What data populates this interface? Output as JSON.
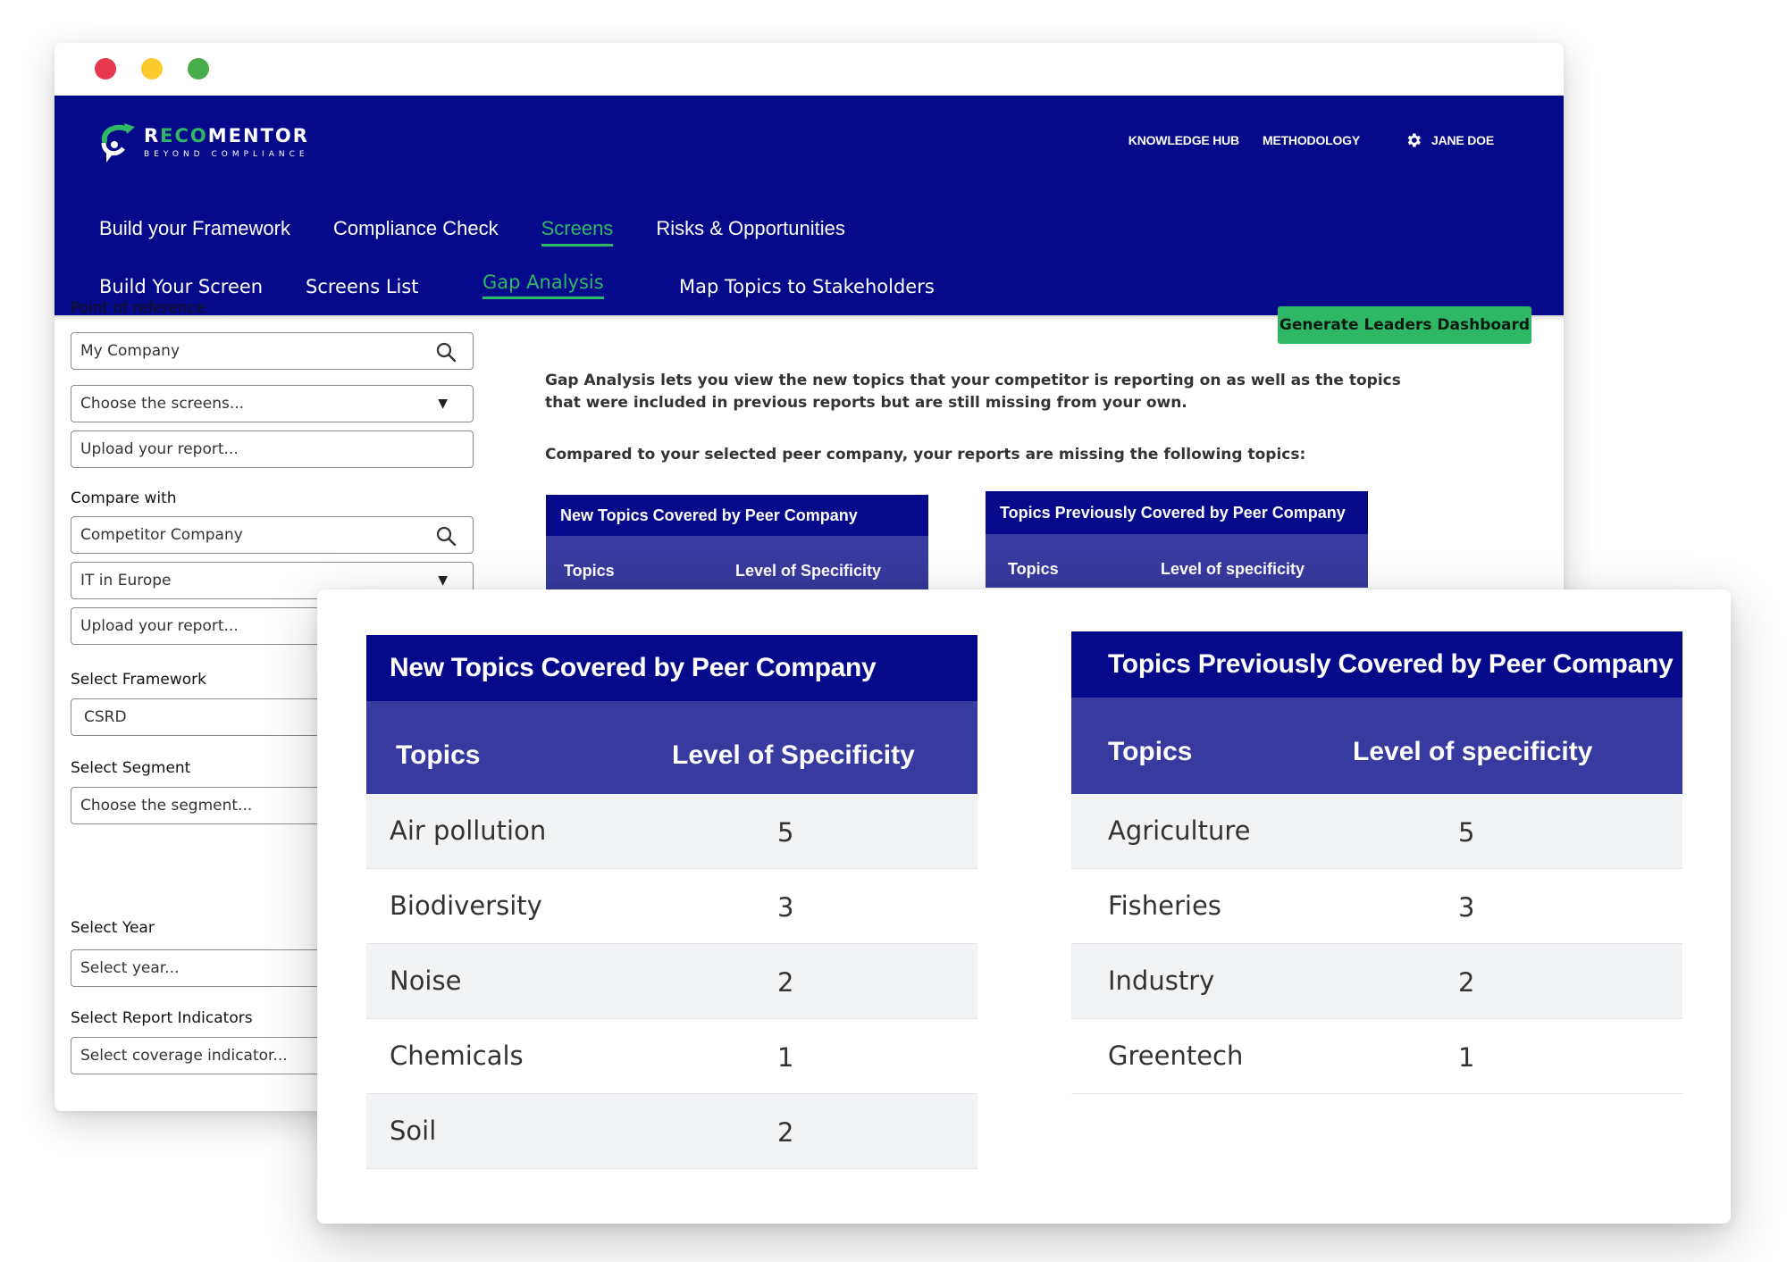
{
  "window": {
    "controls": [
      "close",
      "minimize",
      "maximize"
    ]
  },
  "brand": {
    "name_prefix": "R",
    "name_eco": "ECO",
    "name_suffix": "MENTOR",
    "tagline": "BEYOND COMPLIANCE",
    "colors": {
      "header": "#040a8a",
      "accent": "#2eb865",
      "subheader": "#373a9e"
    }
  },
  "top_links": {
    "knowledge_hub": "KNOWLEDGE HUB",
    "methodology": "METHODOLOGY",
    "user_name": "JANE DOE",
    "user_icon": "gear-icon"
  },
  "main_nav": [
    {
      "label": "Build your Framework",
      "active": false
    },
    {
      "label": "Compliance Check",
      "active": false
    },
    {
      "label": "Screens",
      "active": true
    },
    {
      "label": "Risks & Opportunities",
      "active": false
    }
  ],
  "sub_nav": [
    {
      "label": "Build Your Screen",
      "active": false
    },
    {
      "label": "Screens List",
      "active": false
    },
    {
      "label": "Gap Analysis",
      "active": true
    },
    {
      "label": "Map Topics to Stakeholders",
      "active": false
    }
  ],
  "sidebar": {
    "point_of_reference": {
      "label": "Point of reference",
      "company_value": "My Company",
      "screens_placeholder": "Choose the screens...",
      "upload_placeholder": "Upload your report..."
    },
    "compare_with": {
      "label": "Compare with",
      "company_value": "Competitor Company",
      "screens_value": "IT in Europe",
      "upload_placeholder": "Upload your report..."
    },
    "framework": {
      "label": "Select Framework",
      "value": "CSRD"
    },
    "segment": {
      "label": "Select Segment",
      "placeholder": "Choose the segment..."
    },
    "year": {
      "label": "Select Year",
      "placeholder": "Select year..."
    },
    "indicators": {
      "label": "Select Report Indicators",
      "placeholder": "Select coverage indicator..."
    }
  },
  "main": {
    "generate_button": "Generate Leaders Dashboard",
    "intro": "Gap Analysis lets you view the new topics that your competitor is reporting on as well as the topics that were included in previous reports but are still missing from your own.",
    "missing_note": "Compared to your selected peer company, your reports are missing the following topics:"
  },
  "tables": {
    "new_topics": {
      "title": "New Topics Covered by Peer Company",
      "col_topic": "Topics",
      "col_level": "Level of Specificity",
      "rows": [
        {
          "topic": "Air pollution",
          "level": "5"
        },
        {
          "topic": "Biodiversity",
          "level": "3"
        },
        {
          "topic": "Noise",
          "level": "2"
        },
        {
          "topic": "Chemicals",
          "level": "1"
        },
        {
          "topic": "Soil",
          "level": "2"
        }
      ]
    },
    "previous_topics": {
      "title": "Topics Previously Covered by Peer Company",
      "col_topic": "Topics",
      "col_level": "Level of specificity",
      "rows": [
        {
          "topic": "Agriculture",
          "level": "5"
        },
        {
          "topic": "Fisheries",
          "level": "3"
        },
        {
          "topic": "Industry",
          "level": "2"
        },
        {
          "topic": "Greentech",
          "level": "1"
        }
      ]
    }
  }
}
